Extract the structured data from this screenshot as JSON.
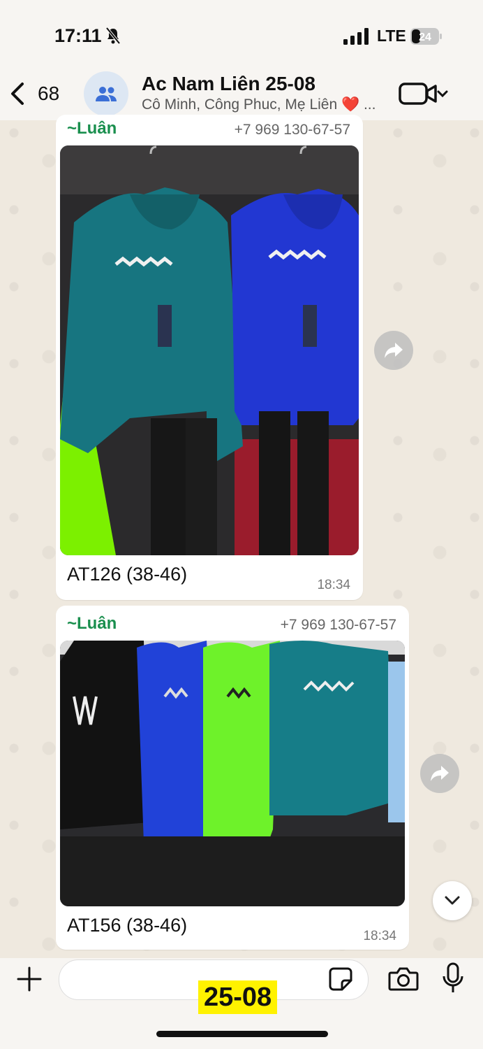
{
  "status_bar": {
    "time": "17:11",
    "network": "LTE",
    "battery": "24"
  },
  "header": {
    "back_count": "68",
    "title": "Ac Nam Liên 25-08",
    "subtitle": "Cô Minh, Công Phuc, Mẹ Liên ❤️ ..."
  },
  "messages": [
    {
      "sender": "~Luân",
      "phone": "+7 969 130-67-57",
      "caption": "AT126 (38-46)",
      "time": "18:34"
    },
    {
      "sender": "~Luân",
      "phone": "+7 969 130-67-57",
      "caption": "AT156 (38-46)",
      "time": "18:34"
    }
  ],
  "overlay_label": "25-08",
  "colors": {
    "sender": "#1a8f4e",
    "accent": "#007aff",
    "overlay": "#fff200"
  }
}
